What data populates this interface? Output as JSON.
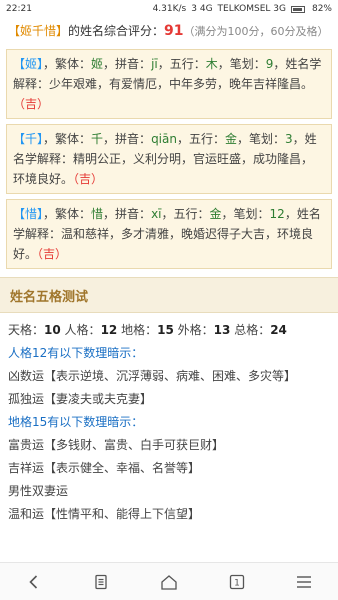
{
  "status_bar": {
    "time": "22:21",
    "net_speed": "4.31K/s",
    "signal": "3 4G",
    "carrier": "TELKOMSEL 3G",
    "battery": "82%"
  },
  "intro": {
    "name_tag": "【姬千惜】",
    "text": "的姓名综合评分：",
    "score": "91",
    "note": "（满分为100分，60分及格）"
  },
  "characters": [
    {
      "char": "【姬】",
      "trad_label": "，繁体：",
      "trad": "姬",
      "pinyin_label": "，拼音：",
      "pinyin": "jī",
      "wuxing_label": "，五行：",
      "wuxing": "木",
      "strokes_label": "，笔划：",
      "strokes": "9",
      "analysis_label": "，姓名学解释：",
      "analysis": "少年艰难，有爱情厄，中年多劳，晚年吉祥隆昌。",
      "verdict": "（吉）"
    },
    {
      "char": "【千】",
      "trad_label": "，繁体：",
      "trad": "千",
      "pinyin_label": "，拼音：",
      "pinyin": "qiān",
      "wuxing_label": "，五行：",
      "wuxing": "金",
      "strokes_label": "，笔划：",
      "strokes": "3",
      "analysis_label": "，姓名学解释：",
      "analysis": "精明公正，义利分明，官运旺盛，成功隆昌，环境良好。",
      "verdict": "（吉）"
    },
    {
      "char": "【惜】",
      "trad_label": "，繁体：",
      "trad": "惜",
      "pinyin_label": "，拼音：",
      "pinyin": "xī",
      "wuxing_label": "，五行：",
      "wuxing": "金",
      "strokes_label": "，笔划：",
      "strokes": "12",
      "analysis_label": "，姓名学解释：",
      "analysis": "温和慈祥，多才清雅，晚婚迟得子大吉，环境良好。",
      "verdict": "（吉）"
    }
  ],
  "section_title": "姓名五格测试",
  "wuge": {
    "tian_label": "天格：",
    "tian": "10",
    "ren_label": "人格：",
    "ren": "12",
    "di_label": "地格：",
    "di": "15",
    "wai_label": "外格：",
    "wai": "13",
    "zong_label": "总格：",
    "zong": "24"
  },
  "ren_heading": "人格12有以下数理暗示：",
  "ren_items": [
    "凶数运【表示逆境、沉浮薄弱、病难、困难、多灾等】",
    "孤独运【妻凌夫或夫克妻】"
  ],
  "di_heading": "地格15有以下数理暗示：",
  "di_items": [
    "富贵运【多钱财、富贵、白手可获巨财】",
    "吉祥运【表示健全、幸福、名誉等】",
    "男性双妻运",
    "温和运【性情平和、能得上下信望】"
  ],
  "bottom_nav": {
    "tab_count": "1"
  }
}
